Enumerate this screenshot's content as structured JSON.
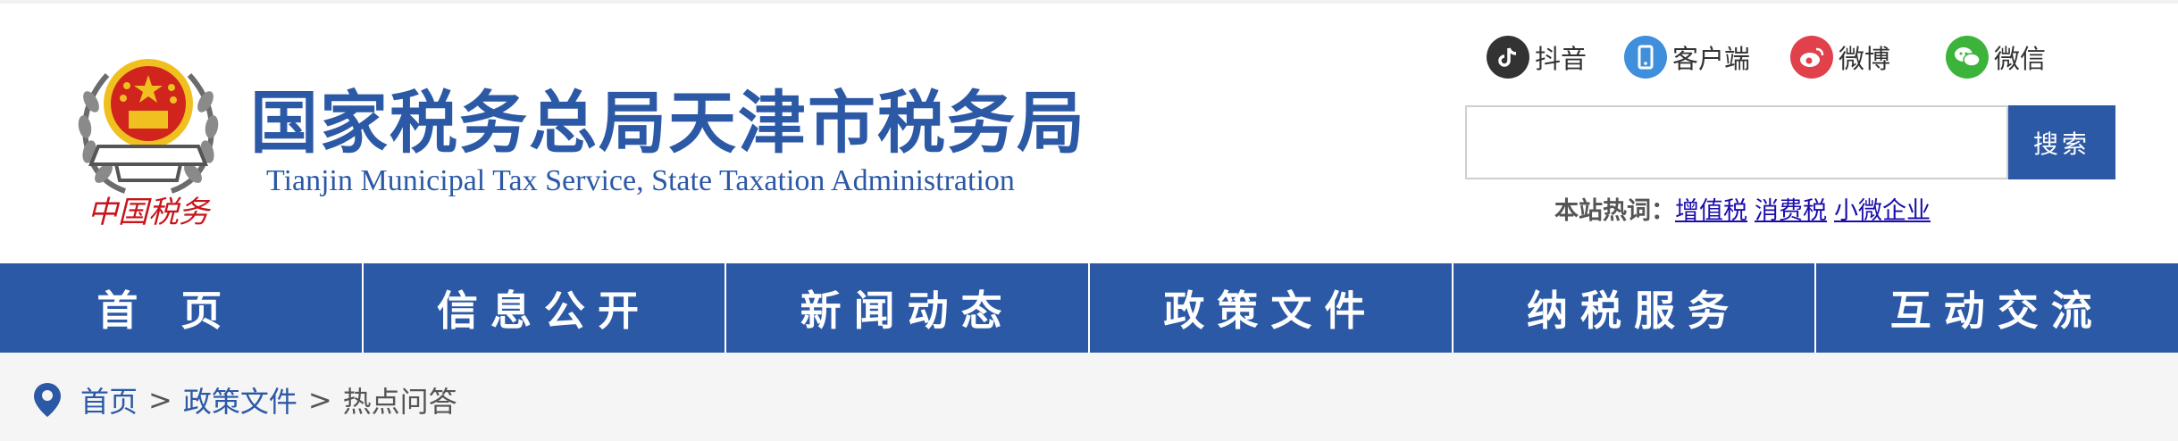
{
  "header": {
    "title_cn": "国家税务总局天津市税务局",
    "title_en": "Tianjin Municipal Tax Service, State Taxation Administration",
    "emblem_text": "中国税务"
  },
  "social": [
    {
      "label": "抖音",
      "icon": "douyin-icon",
      "color": "#333333"
    },
    {
      "label": "客户端",
      "icon": "mobile-app-icon",
      "color": "#3f8fdc"
    },
    {
      "label": "微博",
      "icon": "weibo-icon",
      "color": "#e0414b"
    },
    {
      "label": "微信",
      "icon": "wechat-icon",
      "color": "#3cb43c"
    }
  ],
  "search": {
    "placeholder": "",
    "button_label": "搜索"
  },
  "hot_words": {
    "label": "本站热词：",
    "items": [
      "增值税",
      "消费税",
      "小微企业"
    ]
  },
  "nav": {
    "items": [
      "首页",
      "信息公开",
      "新闻动态",
      "政策文件",
      "纳税服务",
      "互动交流"
    ]
  },
  "breadcrumb": {
    "items": [
      "首页",
      "政策文件"
    ],
    "separator": ">",
    "current": "热点问答"
  },
  "colors": {
    "brand_blue": "#2c59a6",
    "link_blue": "#1a0dab",
    "emblem_red": "#d0241c",
    "emblem_gold": "#f0c020"
  }
}
